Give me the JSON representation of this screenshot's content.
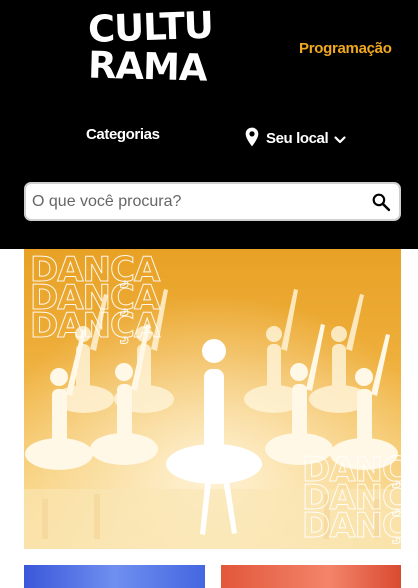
{
  "header": {
    "logo_line1": "CULTU",
    "logo_line2": "RAMA",
    "programacao_label": "Programação",
    "categorias_label": "Categorias",
    "location_label": "Seu local"
  },
  "search": {
    "placeholder": "O que você procura?"
  },
  "banner": {
    "word": "DANÇA"
  },
  "colors": {
    "header_bg": "#000000",
    "accent": "#f0a81e",
    "banner_tint": "#e8a125"
  },
  "icons": [
    "location-pin-icon",
    "chevron-down-icon",
    "search-icon"
  ]
}
